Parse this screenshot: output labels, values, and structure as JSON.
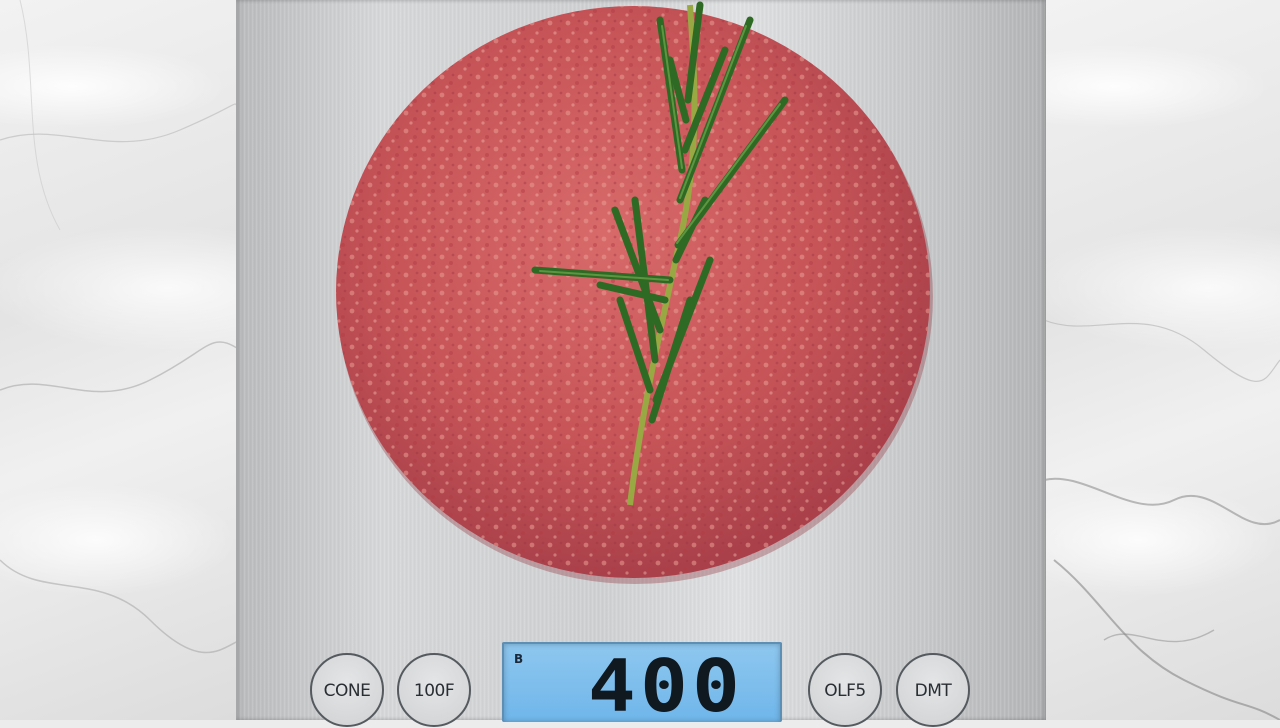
{
  "scene": {
    "background": "marble-countertop",
    "object": "stainless-steel-kitchen-scale",
    "food": "raw-beef-patty",
    "garnish": "rosemary-sprig"
  },
  "display": {
    "mode_label": "B",
    "value": "400"
  },
  "buttons": [
    {
      "label": "CONE"
    },
    {
      "label": "100F"
    },
    {
      "label": "OLF5"
    },
    {
      "label": "DMT"
    }
  ],
  "colors": {
    "display_bg": "#7dbfee",
    "meat": "#c8585a",
    "rosemary": "#3f7a2c",
    "steel": "#d3d5d7"
  },
  "icons": [
    "patty-illustration",
    "rosemary-icon"
  ]
}
